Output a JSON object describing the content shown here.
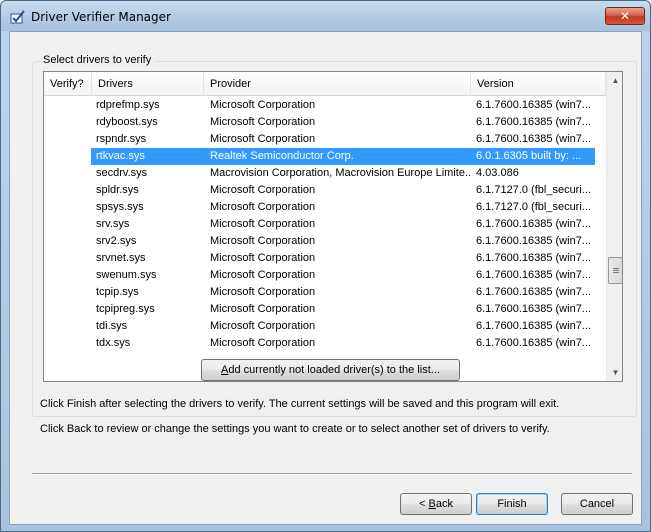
{
  "window": {
    "title": "Driver Verifier Manager",
    "close_label": "✕"
  },
  "group": {
    "label": "Select drivers to verify"
  },
  "columns": [
    "Verify?",
    "Drivers",
    "Provider",
    "Version"
  ],
  "rows": [
    {
      "checked": false,
      "driver": "rdprefmp.sys",
      "provider": "Microsoft Corporation",
      "version": "6.1.7600.16385 (win7..."
    },
    {
      "checked": false,
      "driver": "rdyboost.sys",
      "provider": "Microsoft Corporation",
      "version": "6.1.7600.16385 (win7..."
    },
    {
      "checked": false,
      "driver": "rspndr.sys",
      "provider": "Microsoft Corporation",
      "version": "6.1.7600.16385 (win7..."
    },
    {
      "checked": true,
      "driver": "rtkvac.sys",
      "provider": "Realtek Semiconductor Corp.",
      "version": "6.0.1.6305 built by: ...",
      "selected": true
    },
    {
      "checked": false,
      "driver": "secdrv.sys",
      "provider": "Macrovision Corporation, Macrovision Europe Limite...",
      "version": "4.03.086"
    },
    {
      "checked": false,
      "driver": "spldr.sys",
      "provider": "Microsoft Corporation",
      "version": "6.1.7127.0 (fbl_securi..."
    },
    {
      "checked": false,
      "driver": "spsys.sys",
      "provider": "Microsoft Corporation",
      "version": "6.1.7127.0 (fbl_securi..."
    },
    {
      "checked": false,
      "driver": "srv.sys",
      "provider": "Microsoft Corporation",
      "version": "6.1.7600.16385 (win7..."
    },
    {
      "checked": false,
      "driver": "srv2.sys",
      "provider": "Microsoft Corporation",
      "version": "6.1.7600.16385 (win7..."
    },
    {
      "checked": false,
      "driver": "srvnet.sys",
      "provider": "Microsoft Corporation",
      "version": "6.1.7600.16385 (win7..."
    },
    {
      "checked": false,
      "driver": "swenum.sys",
      "provider": "Microsoft Corporation",
      "version": "6.1.7600.16385 (win7..."
    },
    {
      "checked": false,
      "driver": "tcpip.sys",
      "provider": "Microsoft Corporation",
      "version": "6.1.7600.16385 (win7..."
    },
    {
      "checked": false,
      "driver": "tcpipreg.sys",
      "provider": "Microsoft Corporation",
      "version": "6.1.7600.16385 (win7..."
    },
    {
      "checked": false,
      "driver": "tdi.sys",
      "provider": "Microsoft Corporation",
      "version": "6.1.7600.16385 (win7..."
    },
    {
      "checked": false,
      "driver": "tdx.sys",
      "provider": "Microsoft Corporation",
      "version": "6.1.7600.16385 (win7..."
    }
  ],
  "add_button": {
    "label_underlined": "A",
    "label_rest": "dd currently not loaded driver(s) to the list..."
  },
  "messages": {
    "finish": "Click Finish after selecting the drivers to verify. The current settings will be saved and this program will exit.",
    "back": "Click Back to review or change the settings you want to create or to select another set of drivers to verify."
  },
  "footer": {
    "back_prefix": "< ",
    "back_underlined": "B",
    "back_rest": "ack",
    "finish": "Finish",
    "cancel": "Cancel"
  },
  "icons": {
    "title": "driver-verifier-check-icon",
    "scroll_up": "arrow-up-icon",
    "scroll_down": "arrow-down-icon"
  },
  "colors": {
    "selection": "#3399ff",
    "title_bar": "#b4cde6",
    "close": "#c0391f"
  }
}
